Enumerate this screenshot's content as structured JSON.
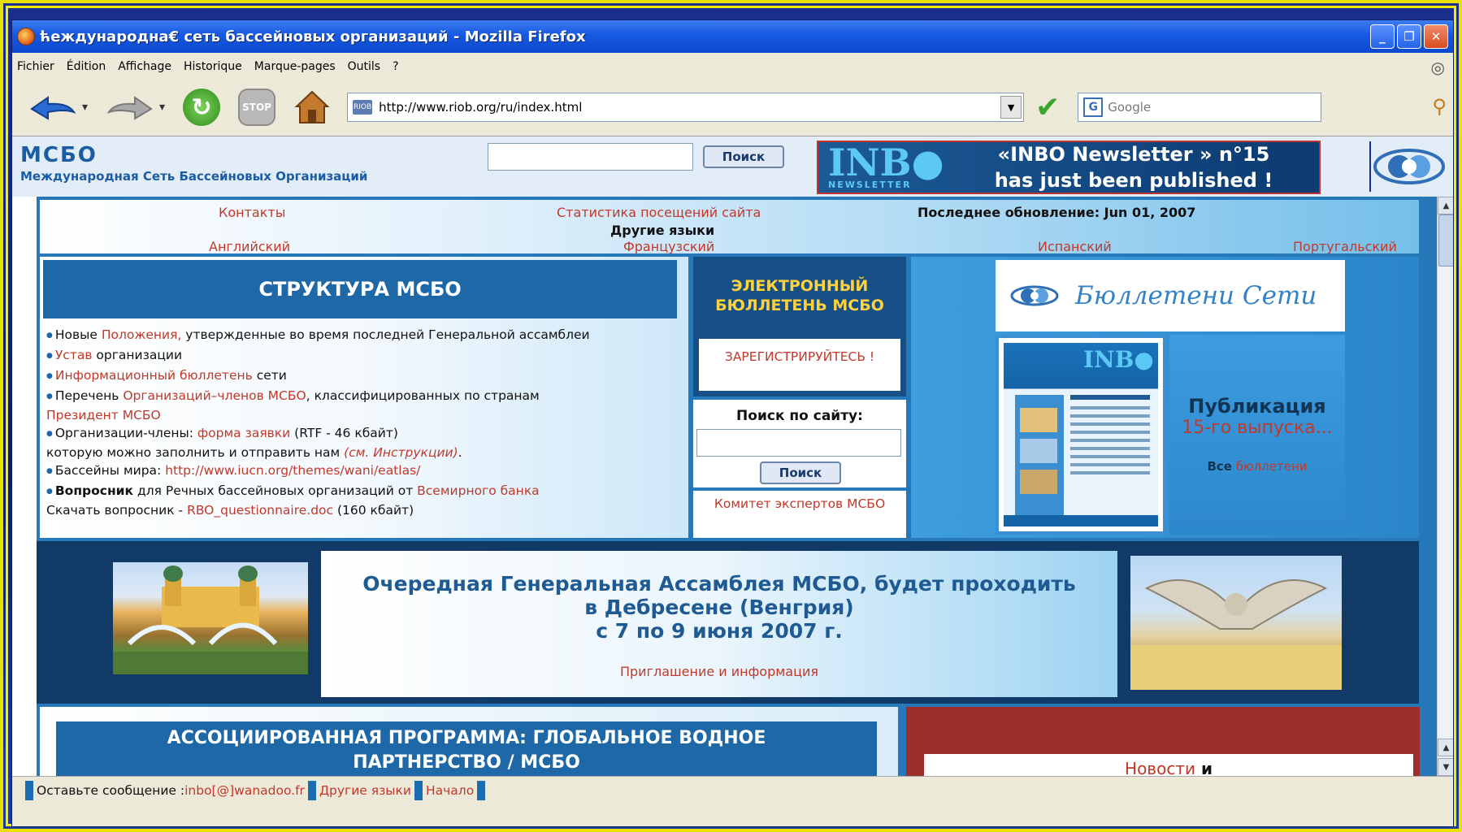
{
  "window": {
    "title": "ћеждународна€ сеть бассейновых организаций - Mozilla Firefox",
    "minimize": "_",
    "restore": "❐",
    "close": "✕"
  },
  "menu": [
    "Fichier",
    "Édition",
    "Affichage",
    "Historique",
    "Marque-pages",
    "Outils",
    "?"
  ],
  "toolbar": {
    "url": "http://www.riob.org/ru/index.html",
    "search_placeholder": "Google",
    "stop_label": "STOP"
  },
  "header": {
    "logo": "МСБО",
    "logo_subtitle": "Международная Сеть Бассейновых Организаций",
    "search_button": "Поиск",
    "banner_logo": "INB",
    "banner_logo_sub": "NEWSLETTER",
    "banner_line1": "«INBO Newsletter » n°15",
    "banner_line2": "has just been published !"
  },
  "toplinks": {
    "contacts": "Контакты",
    "stats": "Статистика посещений сайта",
    "last_update": "Последнее обновление: Jun 01, 2007",
    "other_langs": "Другие языки",
    "english": "Английский",
    "french": "Французский",
    "spanish": "Испанский",
    "portuguese": "Португальский"
  },
  "structure": {
    "title": "СТРУКТУРА МСБО",
    "i1a": "Новые ",
    "i1b": "Положения,",
    "i1c": " утвержденные во время последней Генеральной ассамблеи",
    "i2a": "Устав",
    "i2b": " организации",
    "i3a": "Информационный бюллетень",
    "i3b": " сети",
    "i4a": "Перечень ",
    "i4b": "Организаций–членов МСБО",
    "i4c": ", классифицированных по странам",
    "i4d": "Президент МСБО",
    "i5a": "Организации-члены: ",
    "i5b": "форма заявки",
    "i5c": " (RTF - 46 кбайт)",
    "i5d": "которую можно заполнить и отправить нам ",
    "i5e": "(см. Инструкции)",
    "i5f": ".",
    "i6a": "Бассейны мира: ",
    "i6b": "http://www.iucn.org/themes/wani/eatlas/",
    "i7a": "Вопросник",
    "i7b": " для Речных бассейновых организаций от ",
    "i7c": "Всемирного банка",
    "i7d": "Скачать вопросник - ",
    "i7e": "RBO_questionnaire.doc",
    "i7f": " (160 кбайт)"
  },
  "bulletin": {
    "title": "ЭЛЕКТРОННЫЙ БЮЛЛЕТЕНЬ МСБО",
    "register": "ЗАРЕГИСТРИРУЙТЕСЬ !"
  },
  "site_search": {
    "title": "Поиск по сайту:",
    "button": "Поиск"
  },
  "committee": "Комитет экспертов МСБО",
  "network_bulletins": "Бюллетени Сети",
  "publication": {
    "line1": "Публикация",
    "line2": "15-го выпуска...",
    "all": "Все",
    "bulletins": " бюллетени"
  },
  "assembly": {
    "line1": "Очередная Генеральная Ассамблея МСБО, будет проходить",
    "line2": "в Дебресене (Венгрия)",
    "line3": "с 7 по 9 июня 2007 г.",
    "link": "Приглашение и информация"
  },
  "associated": {
    "line1": "АССОЦИИРОВАННАЯ ПРОГРАММА: ГЛОБАЛЬНОЕ ВОДНОЕ",
    "line2": "ПАРТНЕРСТВО / МСБО"
  },
  "news": {
    "a": "Новости",
    "b": " и"
  },
  "status": {
    "leave": "Оставьте сообщение  : ",
    "email": "inbo[@]wanadoo.fr",
    "other_langs": "Другие языки",
    "home": "Начало"
  }
}
